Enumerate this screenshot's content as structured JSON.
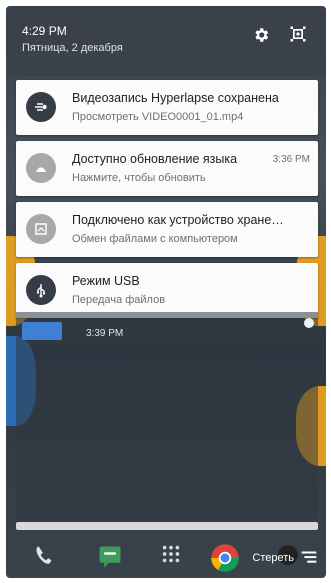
{
  "status_bar": {
    "time": "4:29 PM",
    "date": "Пятница, 2 декабря",
    "icons": [
      "gear-icon",
      "quick-settings-icon"
    ]
  },
  "notifications": [
    {
      "icon": "hyperlapse-icon",
      "title": "Видеозапись Hyperlapse сохранена",
      "subtitle": "Просмотреть VIDEO0001_01.mp4",
      "time": ""
    },
    {
      "icon": "language-update-icon",
      "title": "Доступно обновление языка",
      "subtitle": "Нажмите, чтобы обновить",
      "time": "3:36 PM"
    },
    {
      "icon": "storage-icon",
      "title": "Подключено как устройство хране…",
      "subtitle": "Обмен файлами с компьютером",
      "time": ""
    },
    {
      "icon": "usb-icon",
      "title": "Режим USB",
      "subtitle": "Передача файлов",
      "time": ""
    }
  ],
  "underlying": {
    "time": "3:39 PM"
  },
  "footer": {
    "clear_label": "Стереть"
  },
  "colors": {
    "status_bg": "#3a424b",
    "card_bg": "#fbfbfb",
    "icon_dark": "#353c45",
    "accent_orange": "#e7a11d"
  }
}
